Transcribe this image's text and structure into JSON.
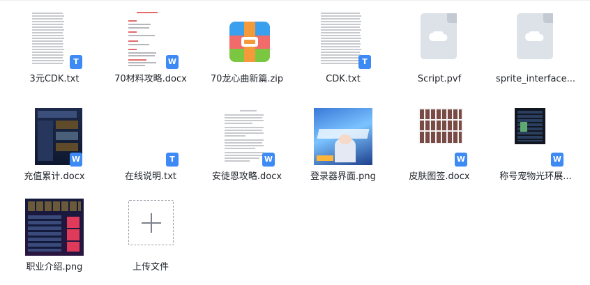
{
  "colors": {
    "word_badge": "#3d8af5",
    "txt_badge": "#3d8af5",
    "accent": "#3d8af5"
  },
  "files": [
    {
      "name": "3元CDK.txt",
      "kind": "txt",
      "badge": "T",
      "icon": "text-file-icon"
    },
    {
      "name": "70材料攻略.docx",
      "kind": "docx",
      "badge": "W",
      "icon": "word-file-icon"
    },
    {
      "name": "70龙心曲新篇.zip",
      "kind": "zip",
      "icon": "zip-archive-icon"
    },
    {
      "name": "CDK.txt",
      "kind": "txt",
      "badge": "T",
      "icon": "text-file-icon"
    },
    {
      "name": "Script.pvf",
      "kind": "generic",
      "icon": "cloud-file-icon"
    },
    {
      "name": "sprite_interface...",
      "kind": "generic",
      "icon": "cloud-file-icon"
    },
    {
      "name": "充值累计.docx",
      "kind": "docx",
      "badge": "W",
      "icon": "word-file-icon"
    },
    {
      "name": "在线说明.txt",
      "kind": "txt",
      "badge": "T",
      "icon": "text-file-icon"
    },
    {
      "name": "安徒恩攻略.docx",
      "kind": "docx",
      "badge": "W",
      "icon": "word-file-icon"
    },
    {
      "name": "登录器界面.png",
      "kind": "png",
      "icon": "image-file-icon"
    },
    {
      "name": "皮肤图签.docx",
      "kind": "docx",
      "badge": "W",
      "icon": "word-file-icon"
    },
    {
      "name": "称号宠物光环展...",
      "kind": "docx",
      "badge": "W",
      "icon": "word-file-icon"
    },
    {
      "name": "职业介绍.png",
      "kind": "png",
      "icon": "image-file-icon"
    }
  ],
  "upload": {
    "label": "上传文件",
    "icon": "plus-icon"
  }
}
